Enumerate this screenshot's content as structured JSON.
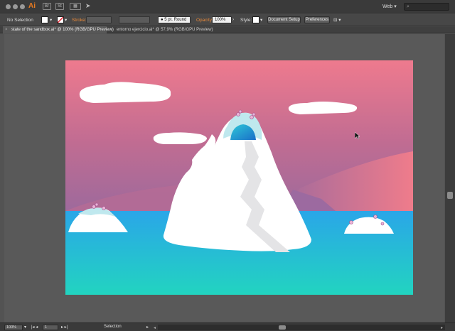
{
  "app": {
    "logo": "Ai",
    "workspace": "Web",
    "search_placeholder": ""
  },
  "control_bar": {
    "selection": "No Selection",
    "stroke_label": "Stroke:",
    "brush_value": "5 pt. Round",
    "opacity_label": "Opacity:",
    "opacity_value": "100%",
    "style_label": "Style:",
    "document_setup": "Document Setup",
    "preferences": "Preferences"
  },
  "tabs": [
    {
      "label": "state of the sandbox.ai* @ 100% (RGB/GPU Preview)",
      "active": true
    },
    {
      "label": "entorno ejercicio.ai* @ 57,9% (RGB/GPU Preview)",
      "active": false
    }
  ],
  "status_bar": {
    "zoom": "100%",
    "artboard_number": "1",
    "tool": "Selection"
  },
  "colors": {
    "sky_top": "#ee7a8e",
    "sky_bottom": "#9e6a9c",
    "water_top": "#2aa6e8",
    "water_bottom": "#22d4c0",
    "stroke_accent": "#e8893a"
  }
}
